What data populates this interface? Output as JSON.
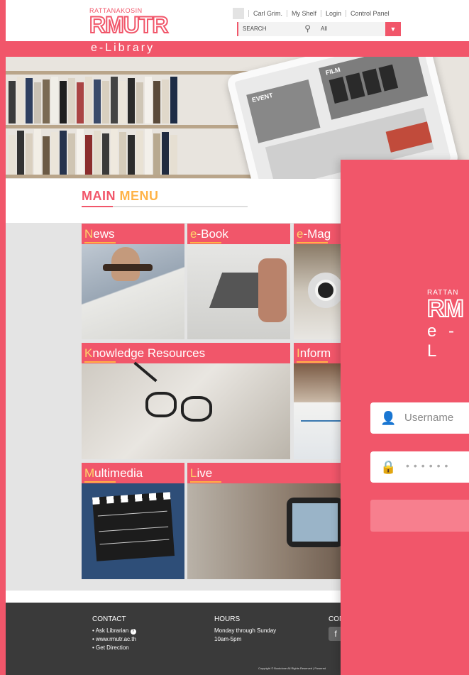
{
  "header": {
    "logo_small": "RATTANAKOSIN",
    "logo_big": "RMUTR",
    "links": [
      "Carl Grim.",
      "My Shelf",
      "Login",
      "Control Panel"
    ],
    "search_label": "SEARCH",
    "select_value": "All"
  },
  "banner": {
    "strip_text": "e-Library",
    "tablet": {
      "event_label": "EVENT",
      "film_label": "FILM"
    }
  },
  "main_menu": {
    "title_word1": "MAIN",
    "title_word2": "MENU",
    "tiles": [
      {
        "label_first": "N",
        "label_rest": "ews"
      },
      {
        "label_first": "e",
        "label_rest": "-Book"
      },
      {
        "label_first": "e",
        "label_rest": "-Mag"
      },
      {
        "label_first": "K",
        "label_rest": "nowledge Resources"
      },
      {
        "label_first": "I",
        "label_rest": "nform"
      },
      {
        "label_first": "M",
        "label_rest": "ultimedia"
      },
      {
        "label_first": "L",
        "label_rest": "ive"
      }
    ]
  },
  "footer": {
    "contact_title": "CONTACT",
    "contact_items": [
      "Ask Librarian",
      "www.rmutr.ac.th",
      "Get Direction"
    ],
    "hours_title": "HOURS",
    "hours_line1": "Monday through Sunday",
    "hours_line2": "10am-5pm",
    "col3_title": "CON",
    "copyright": "Copyright © Bookdose All Rights Reserved | Powered"
  },
  "login": {
    "logo_small": "RATTAN",
    "logo_big": "RM",
    "logo_sub": "e - L",
    "username_placeholder": "Username",
    "password_mask": "••••••"
  },
  "colors": {
    "primary": "#f1566a",
    "accent": "#ffb347",
    "footer_bg": "#3a3a3a",
    "grid_bg": "#e4e4e4"
  }
}
